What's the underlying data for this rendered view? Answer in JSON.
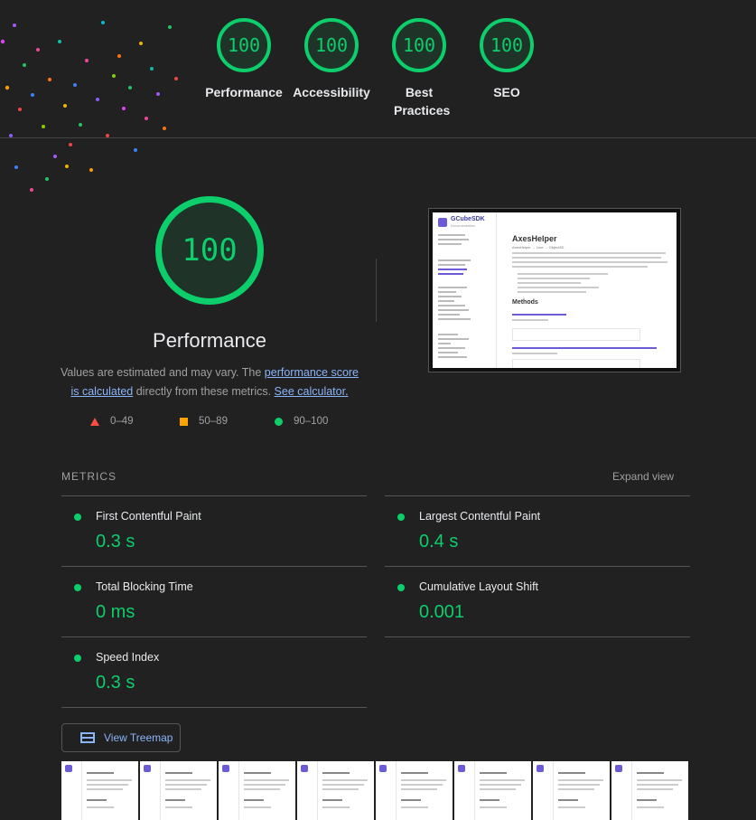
{
  "summary_gauges": [
    {
      "score": "100",
      "label": "Performance"
    },
    {
      "score": "100",
      "label": "Accessibility"
    },
    {
      "score": "100",
      "label": "Best Practices"
    },
    {
      "score": "100",
      "label": "SEO"
    }
  ],
  "performance": {
    "score": "100",
    "title": "Performance",
    "desc_prefix": "Values are estimated and may vary. The ",
    "desc_link1": "performance score is calculated",
    "desc_middle": " directly from these metrics. ",
    "desc_link2": "See calculator."
  },
  "legend": {
    "fail": "0–49",
    "average": "50–89",
    "pass": "90–100"
  },
  "screenshot": {
    "brand": "GCubeSDK",
    "brand_sub": "Documentation",
    "page_title": "AxesHelper",
    "breadcrumb": "AxesHelper → Line → Object3D",
    "section": "Methods"
  },
  "metrics": {
    "heading": "METRICS",
    "expand_label": "Expand view",
    "items": [
      {
        "name": "First Contentful Paint",
        "value": "0.3 s"
      },
      {
        "name": "Largest Contentful Paint",
        "value": "0.4 s"
      },
      {
        "name": "Total Blocking Time",
        "value": "0 ms"
      },
      {
        "name": "Cumulative Layout Shift",
        "value": "0.001"
      },
      {
        "name": "Speed Index",
        "value": "0.3 s"
      }
    ]
  },
  "treemap": {
    "label": "View Treemap"
  },
  "colors": {
    "pass": "#0cce6b",
    "average": "#ffa400",
    "fail": "#ff4e42",
    "link": "#8ab4f8",
    "background": "#212121"
  }
}
